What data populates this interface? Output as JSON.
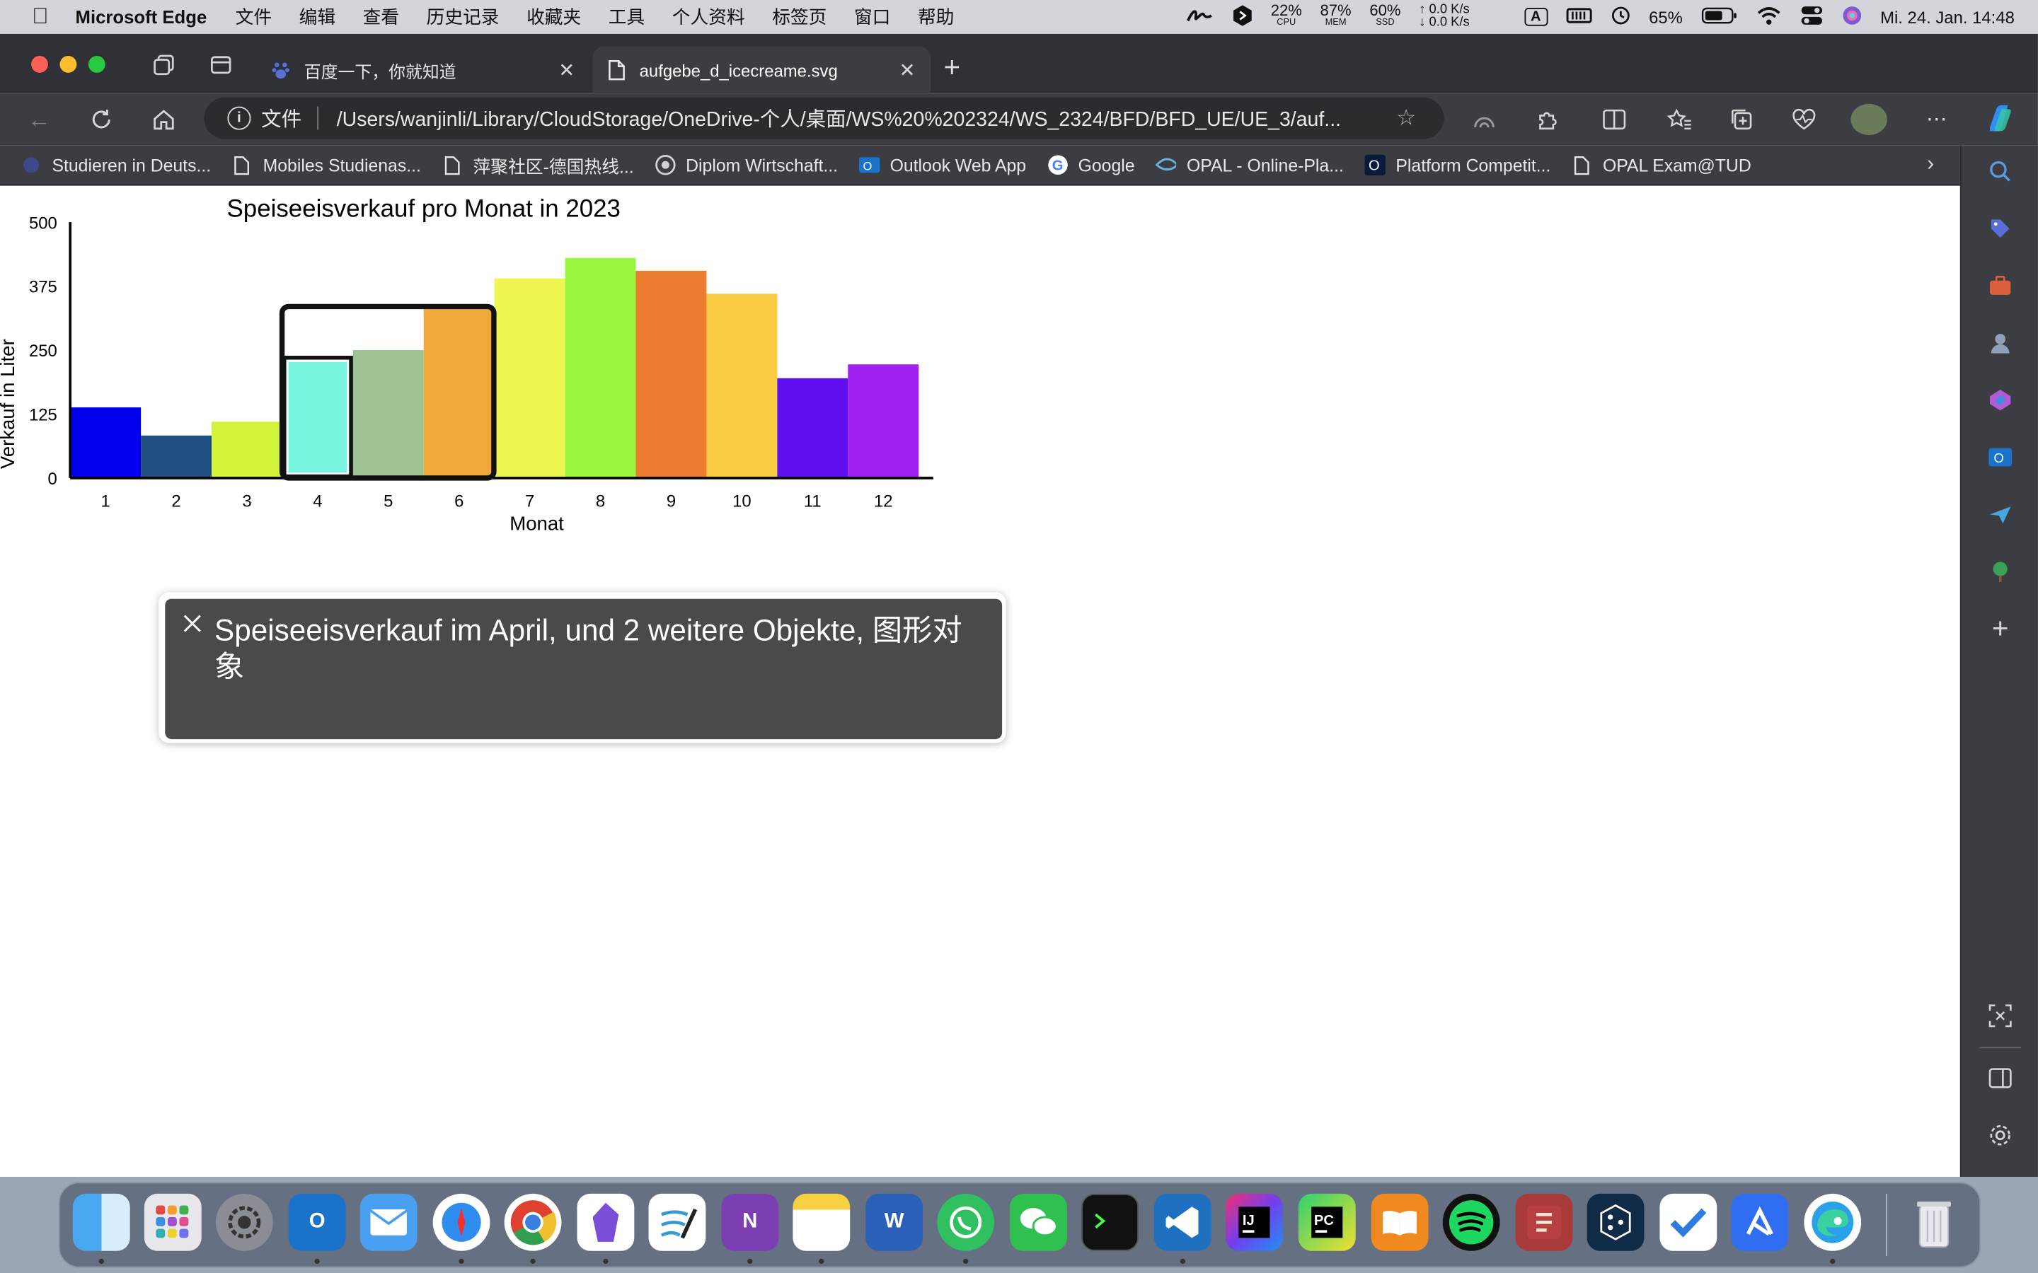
{
  "menubar": {
    "app_name": "Microsoft Edge",
    "menus": [
      "文件",
      "编辑",
      "查看",
      "历史记录",
      "收藏夹",
      "工具",
      "个人资料",
      "标签页",
      "窗口",
      "帮助"
    ],
    "cpu": {
      "value": "22%",
      "label": "CPU"
    },
    "mem": {
      "value": "87%",
      "label": "MEM"
    },
    "ssd": {
      "value": "60%",
      "label": "SSD"
    },
    "net_up": "↑ 0.0 K/s",
    "net_down": "↓ 0.0 K/s",
    "input_source": "A",
    "battery": "65%",
    "datetime": "Mi. 24. Jan.  14:48"
  },
  "tabs": [
    {
      "title": "百度一下，你就知道",
      "active": false
    },
    {
      "title": "aufgebe_d_icecreame.svg",
      "active": true
    }
  ],
  "address": {
    "scheme_label": "文件",
    "url": "/Users/wanjinli/Library/CloudStorage/OneDrive-个人/桌面/WS%20%202324/WS_2324/BFD/BFD_UE/UE_3/auf..."
  },
  "bookmarks": [
    "Studieren in Deuts...",
    "Mobiles Studienas...",
    "萍聚社区-德国热线...",
    "Diplom Wirtschaft...",
    "Outlook Web App",
    "Google",
    "OPAL - Online-Pla...",
    "Platform Competit...",
    "OPAL Exam@TUD"
  ],
  "chart_data": {
    "type": "bar",
    "title": "Speiseeisverkauf pro Monat in 2023",
    "xlabel": "Monat",
    "ylabel": "Verkauf in Liter",
    "ylim": [
      0,
      500
    ],
    "yticks": [
      "0",
      "125",
      "250",
      "375",
      "500"
    ],
    "categories": [
      "1",
      "2",
      "3",
      "4",
      "5",
      "6",
      "7",
      "8",
      "9",
      "10",
      "11",
      "12"
    ],
    "values": [
      138,
      83,
      110,
      230,
      250,
      330,
      390,
      430,
      405,
      360,
      195,
      222
    ],
    "colors": [
      "#0000ee",
      "#1f4e80",
      "#d2f53c",
      "#77f5df",
      "#9ec190",
      "#f1a83b",
      "#eef752",
      "#9bf73e",
      "#ed7d31",
      "#f9cc43",
      "#5f0ff0",
      "#a020f0"
    ],
    "grid": false,
    "legend": "none",
    "highlight": {
      "group_months": [
        "4",
        "5",
        "6"
      ],
      "focused_month": "4"
    }
  },
  "tooltip": {
    "text": "Speiseeisverkauf im April, und 2 weitere Objekte, 图形对象"
  },
  "colors": {
    "browser_chrome": "#3b3d42",
    "tab_strip": "#2f3136",
    "menubar": "#d3d5da"
  }
}
